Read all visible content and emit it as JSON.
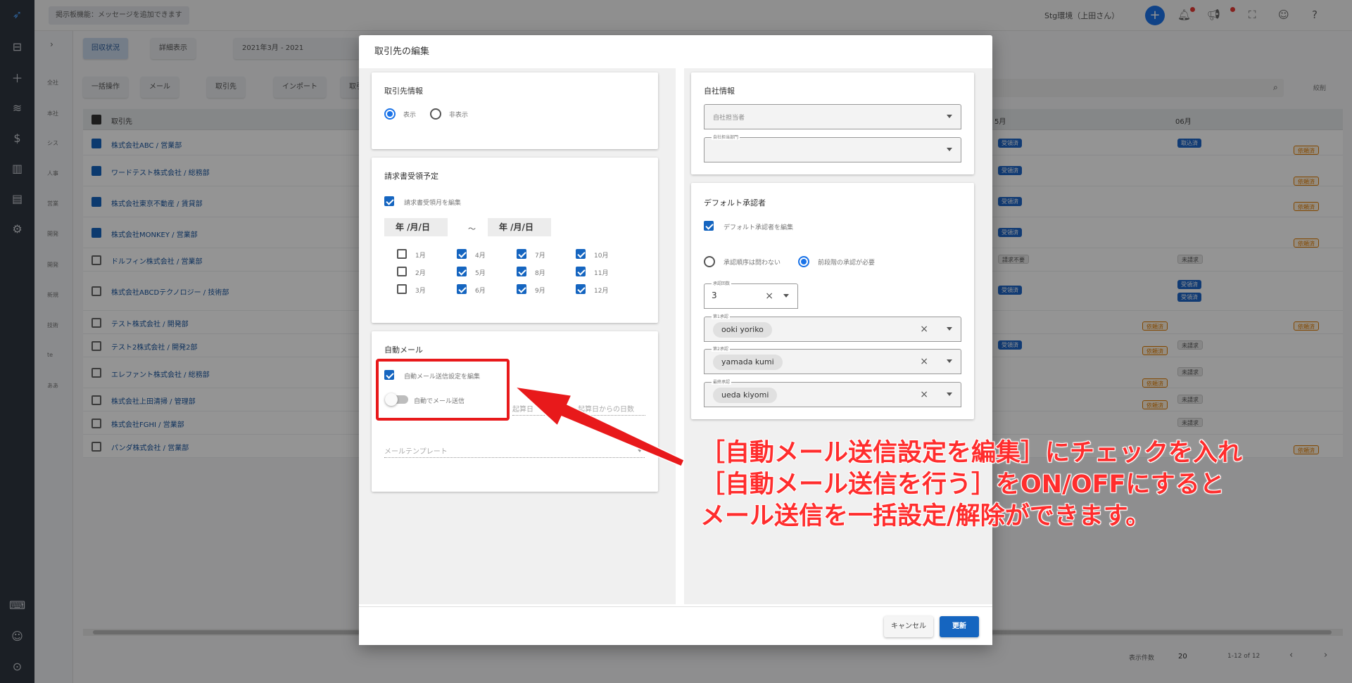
{
  "header": {
    "bulletin": "掲示板機能：メッセージを追加できます",
    "environment": "Stg環境（上田さん）"
  },
  "side_categories": [
    "全社",
    "本社",
    "シス",
    "人事",
    "営業",
    "開発",
    "開発",
    "新規",
    "技術",
    "te",
    "ああ"
  ],
  "background": {
    "view_tabs": [
      "回収状況",
      "詳細表示"
    ],
    "period": "2021年3月 - 2021",
    "actions": [
      "一括操作",
      "メール",
      "取引先",
      "インポート",
      "取引"
    ],
    "filter_label": "絞削",
    "column_header": "取引先",
    "month_header_1": "5月",
    "month_header_2": "06月",
    "rows": [
      {
        "name": "株式会社ABC / 営業部",
        "checked": true
      },
      {
        "name": "ワードテスト株式会社 / 総務部",
        "checked": true
      },
      {
        "name": "株式会社東京不動産 / 賃貸部",
        "checked": true
      },
      {
        "name": "株式会社MONKEY / 営業部",
        "checked": true
      },
      {
        "name": "ドルフィン株式会社 / 営業部",
        "checked": false
      },
      {
        "name": "株式会社ABCDテクノロジー / 技術部",
        "checked": false
      },
      {
        "name": "テスト株式会社 / 開発部",
        "checked": false
      },
      {
        "name": "テスト2株式会社 / 開発2部",
        "checked": false
      },
      {
        "name": "エレファント株式会社 / 総務部",
        "checked": false
      },
      {
        "name": "株式会社上田清掃 / 管理部",
        "checked": false
      },
      {
        "name": "株式会社FGHI / 営業部",
        "checked": false
      },
      {
        "name": "パンダ株式会社 / 営業部",
        "checked": false
      }
    ],
    "badges": {
      "received": "受領済",
      "sent": "取込済",
      "requested": "依頼済",
      "unbilled": "未請求",
      "unneeded": "請求不要"
    },
    "footer": {
      "rows_label": "表示件数",
      "rows_value": "20",
      "range": "1-12 of 12"
    }
  },
  "modal": {
    "title": "取引先の編集",
    "partner_info": {
      "title": "取引先情報",
      "show_label": "表示",
      "hide_label": "非表示"
    },
    "invoice_schedule": {
      "title": "請求書受領予定",
      "edit_label": "請求書受領月を編集",
      "date_from": "年 /月/日",
      "date_sep": "～",
      "date_to": "年 /月/日",
      "months": [
        {
          "label": "1月",
          "checked": false
        },
        {
          "label": "4月",
          "checked": true
        },
        {
          "label": "7月",
          "checked": true
        },
        {
          "label": "10月",
          "checked": true
        },
        {
          "label": "2月",
          "checked": false
        },
        {
          "label": "5月",
          "checked": true
        },
        {
          "label": "8月",
          "checked": true
        },
        {
          "label": "11月",
          "checked": true
        },
        {
          "label": "3月",
          "checked": false
        },
        {
          "label": "6月",
          "checked": true
        },
        {
          "label": "9月",
          "checked": true
        },
        {
          "label": "12月",
          "checked": true
        }
      ]
    },
    "auto_mail": {
      "title": "自動メール",
      "edit_label": "自動メール送信設定を編集",
      "toggle_label": "自動でメール送信",
      "start_placeholder": "起算日",
      "days_placeholder": "起算日からの日数",
      "template_placeholder": "メールテンプレート"
    },
    "company_info": {
      "title": "自社情報",
      "owner_placeholder": "自社担当者",
      "dept_label": "自社担当部門"
    },
    "default_approver": {
      "title": "デフォルト承認者",
      "edit_label": "デフォルト承認者を編集",
      "order_any": "承認順序は問わない",
      "order_required": "前段階の承認が必要",
      "count_label": "承認回数",
      "count_value": "3",
      "approver1_label": "第1承認",
      "approver1": "ooki yoriko",
      "approver2_label": "第2承認",
      "approver2": "yamada kumi",
      "final_label": "最終承認",
      "final": "ueda kiyomi"
    },
    "cancel_label": "キャンセル",
    "update_label": "更新"
  },
  "annotation": {
    "line1": "［自動メール送信設定を編集］にチェックを入れ",
    "line2": "［自動メール送信を行う］をON/OFFにすると",
    "line3": "メール送信を一括設定/解除ができます。",
    "color": "#ff2d2d"
  }
}
